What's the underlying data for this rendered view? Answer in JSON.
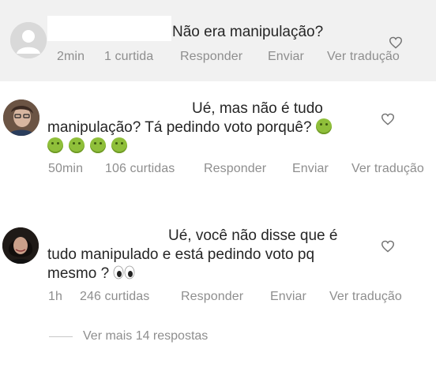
{
  "comments": [
    {
      "text_lines": [
        "Não era manipulação?"
      ],
      "meta": {
        "time": "2min",
        "likes": "1 curtida",
        "reply": "Responder",
        "send": "Enviar",
        "translate": "Ver tradução"
      }
    },
    {
      "text_lines": [
        "Ué, mas não é tudo",
        "manipulação? Tá pedindo voto porquê?"
      ],
      "emoji_count_line1": 1,
      "emoji_count_line2": 4,
      "meta": {
        "time": "50min",
        "likes": "106 curtidas",
        "reply": "Responder",
        "send": "Enviar",
        "translate": "Ver tradução"
      }
    },
    {
      "text_lines": [
        "Ué, você não disse que é",
        "tudo manipulado e está pedindo voto pq",
        "mesmo ?"
      ],
      "meta": {
        "time": "1h",
        "likes": "246 curtidas",
        "reply": "Responder",
        "send": "Enviar",
        "translate": "Ver tradução"
      }
    }
  ],
  "view_more": "Ver mais 14 respostas",
  "icons": {
    "like": "heart-outline-icon",
    "sick_emoji": "nauseated-face-emoji",
    "eyes_emoji": "eyes-emoji"
  },
  "colors": {
    "meta_text": "#8e8e8e",
    "highlight_bg": "#f1f1f1",
    "text": "#262626"
  }
}
